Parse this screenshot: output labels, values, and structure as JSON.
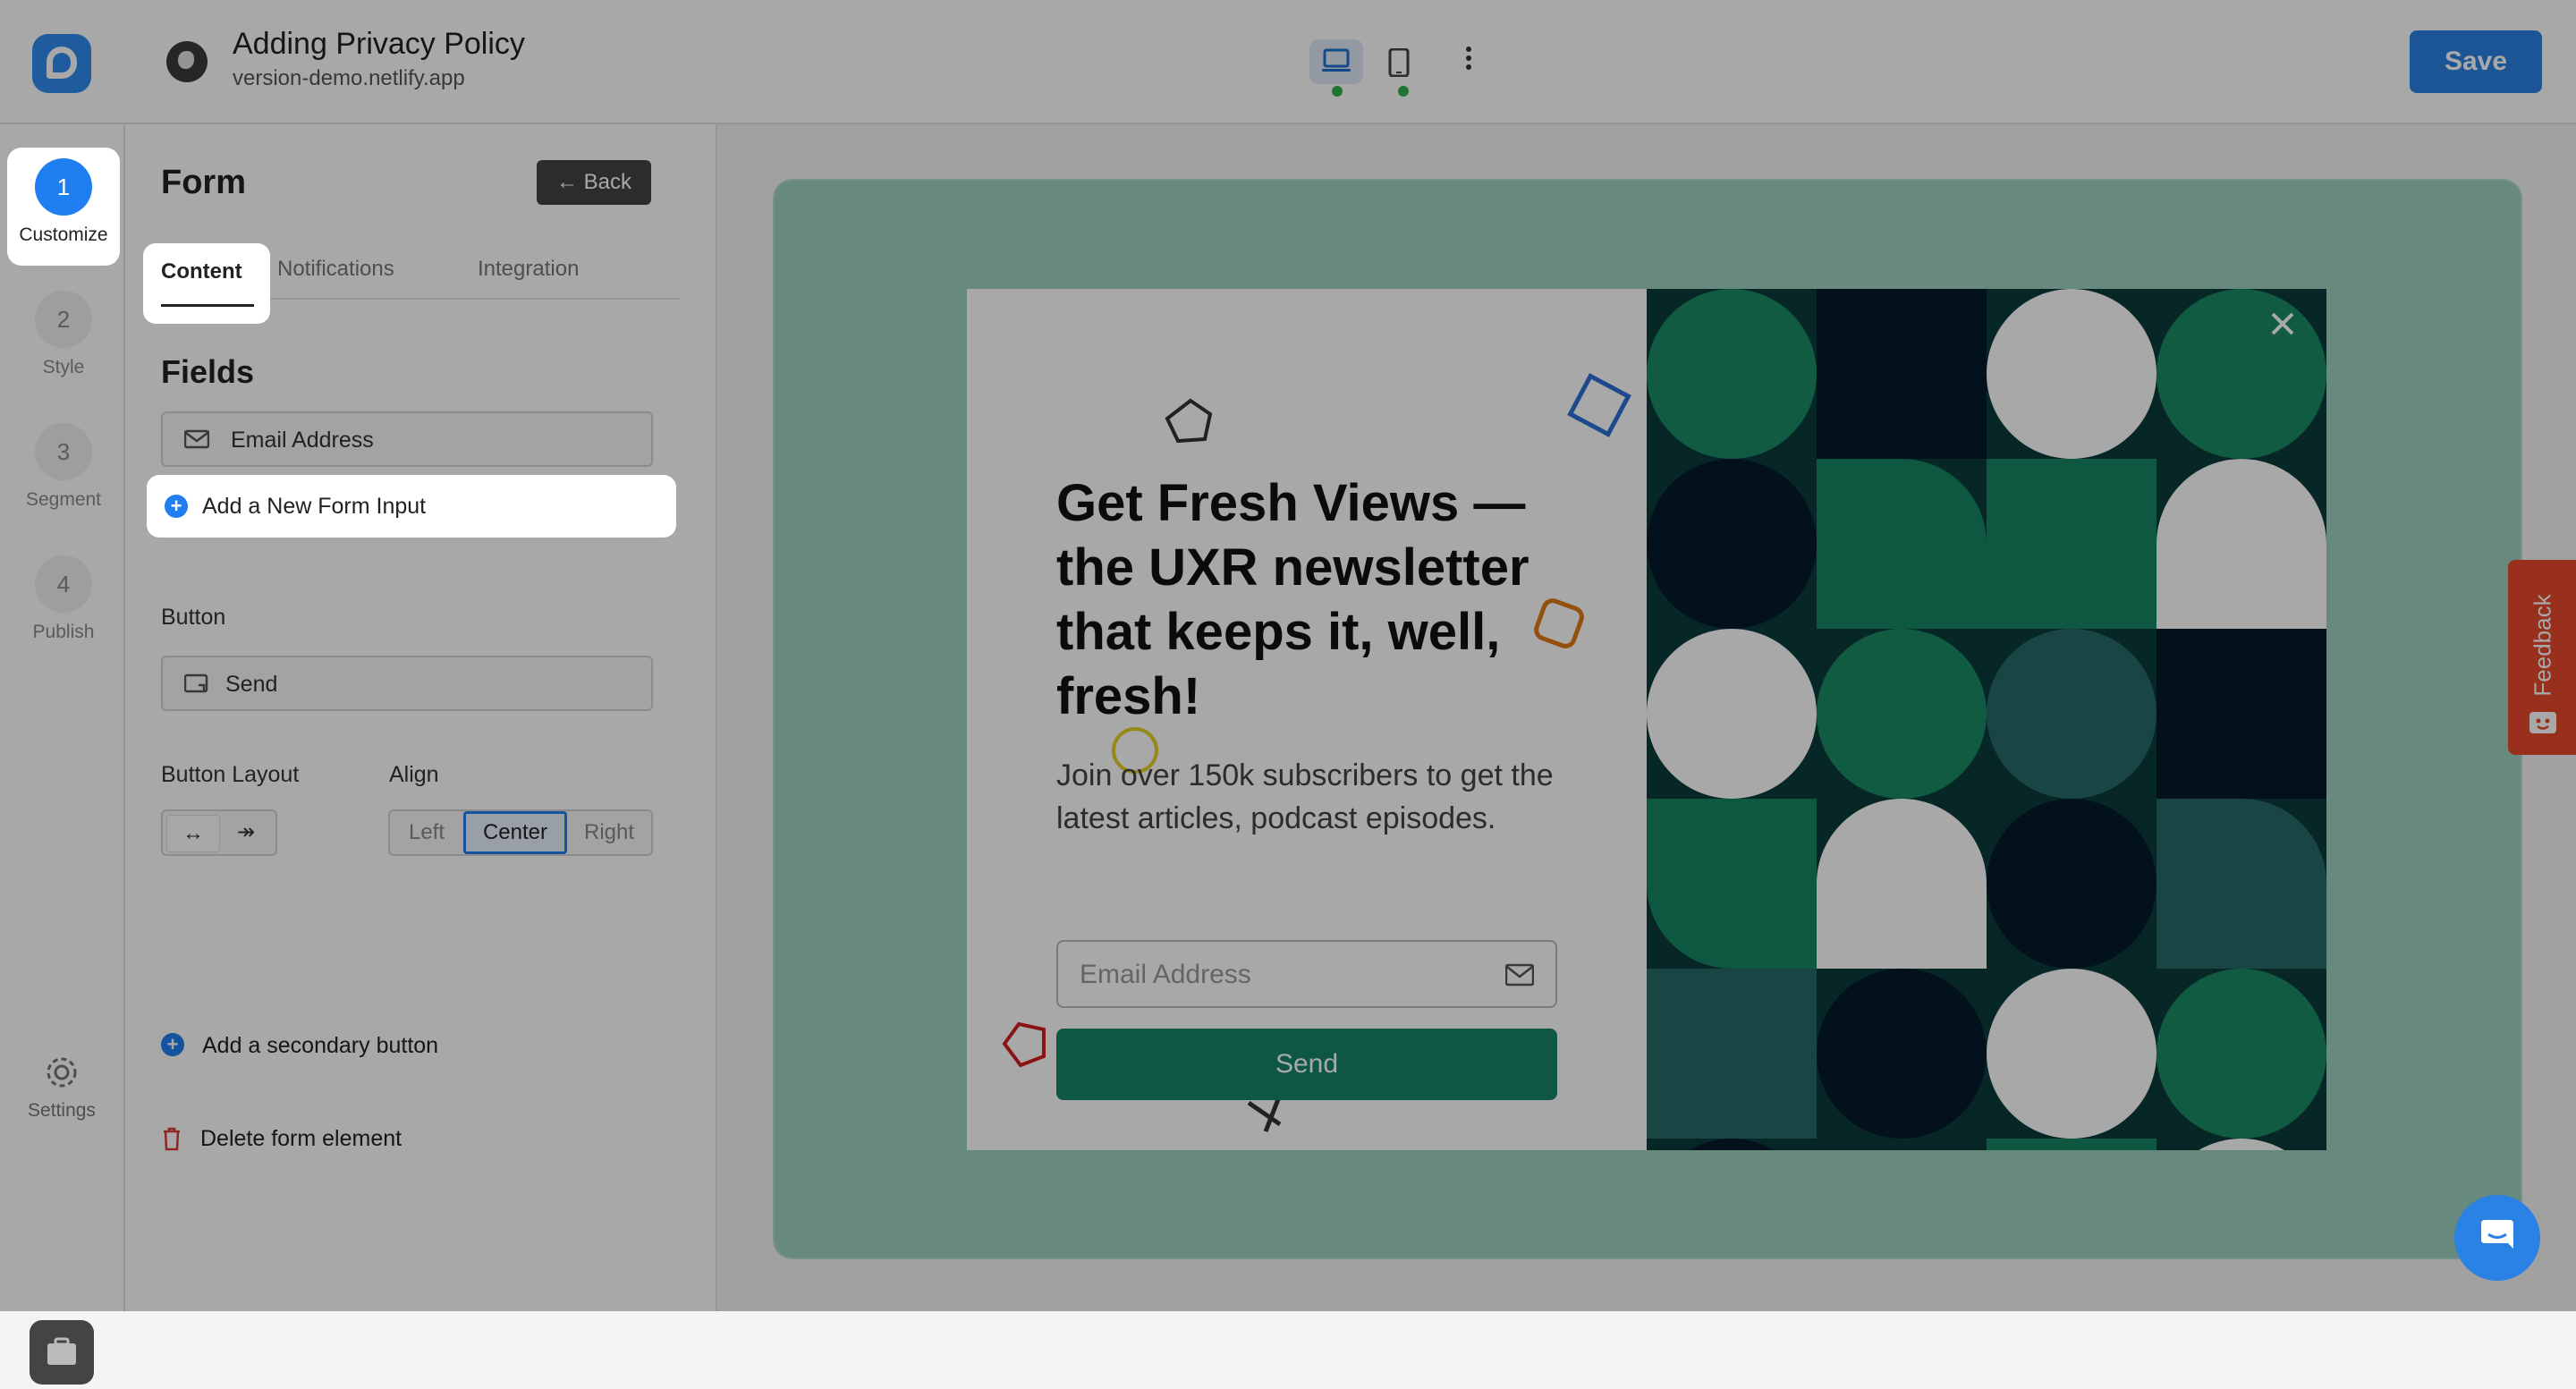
{
  "header": {
    "title": "Adding Privacy Policy",
    "url": "version-demo.netlify.app",
    "save_label": "Save"
  },
  "steps": [
    {
      "number": "1",
      "label": "Customize",
      "active": true
    },
    {
      "number": "2",
      "label": "Style"
    },
    {
      "number": "3",
      "label": "Segment"
    },
    {
      "number": "4",
      "label": "Publish"
    }
  ],
  "rail": {
    "settings_label": "Settings"
  },
  "panel": {
    "title": "Form",
    "back_label": "Back",
    "tabs": [
      "Content",
      "Notifications",
      "Integration"
    ],
    "fields_heading": "Fields",
    "email_field": "Email Address",
    "add_input_label": "Add a New Form Input",
    "button_heading": "Button",
    "button_field": "Send",
    "layout_label": "Button Layout",
    "align_label": "Align",
    "layout_options": [
      "↔",
      "↠"
    ],
    "align_options": [
      "Left",
      "Center",
      "Right"
    ],
    "add_secondary_label": "Add a secondary button",
    "delete_label": "Delete form element"
  },
  "popup": {
    "headline": "Get Fresh Views — the UXR newsletter that keeps it, well, fresh!",
    "subtext": "Join over 150k subscribers to get the latest articles, podcast episodes.",
    "email_placeholder": "Email Address",
    "send_label": "Send"
  },
  "feedback_label": "Feedback",
  "colors": {
    "accent": "#2a82e4",
    "popup_button": "#17846a",
    "feedback": "#e8492c"
  }
}
